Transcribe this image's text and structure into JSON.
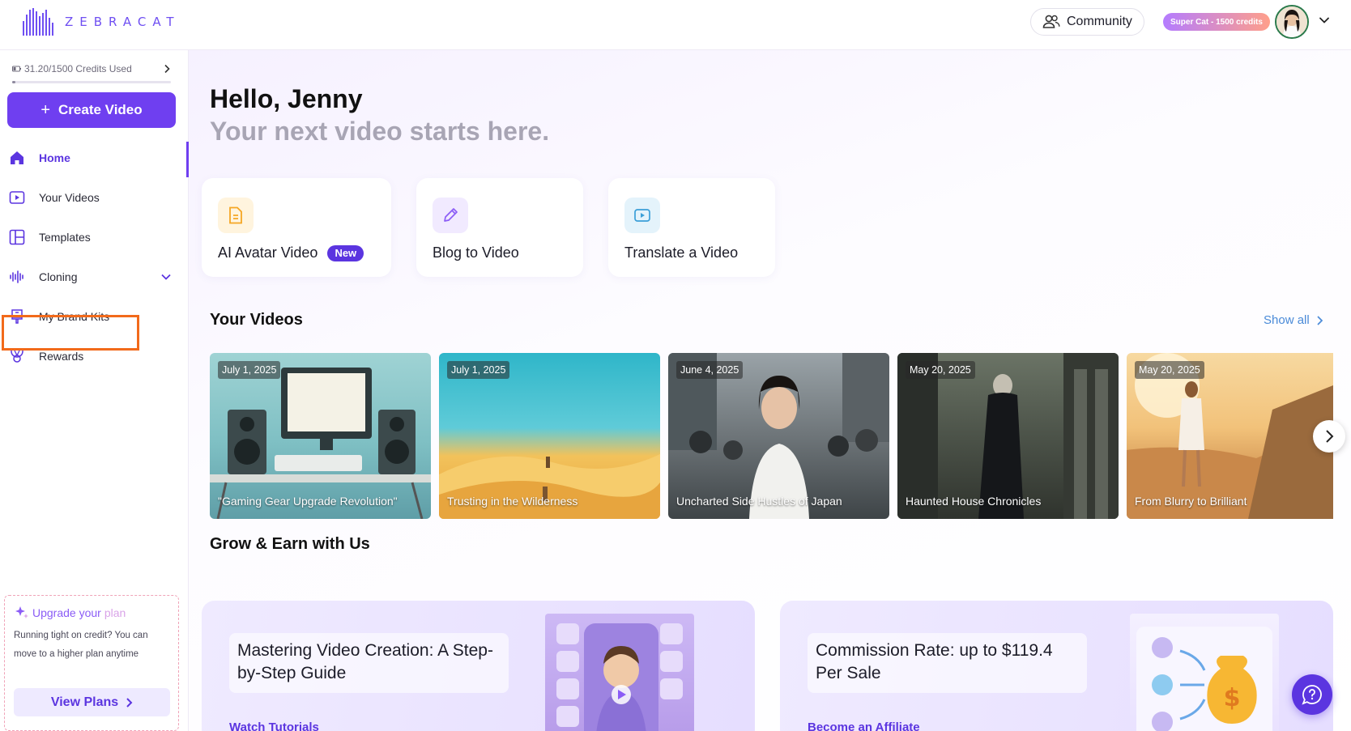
{
  "header": {
    "logo_text": "ZEBRACAT",
    "community_label": "Community",
    "plan_badge": "Super Cat - 1500 credits",
    "avatar_icon": "user-avatar"
  },
  "sidebar": {
    "credits_text": "31.20/1500 Credits Used",
    "credits_used_fraction": 0.0208,
    "create_label": "Create Video",
    "items": [
      {
        "label": "Home",
        "icon": "home-icon",
        "active": true
      },
      {
        "label": "Your Videos",
        "icon": "play-icon"
      },
      {
        "label": "Templates",
        "icon": "layout-icon"
      },
      {
        "label": "Cloning",
        "icon": "waveform-icon"
      },
      {
        "label": "My Brand Kits",
        "icon": "brand-icon"
      },
      {
        "label": "Rewards",
        "icon": "trophy-icon"
      }
    ],
    "upgrade": {
      "title_prefix": "Upgrade your",
      "title_suffix": "plan",
      "description": "Running tight on credit? You can move to a higher plan anytime",
      "button": "View Plans"
    }
  },
  "main": {
    "greeting": "Hello, Jenny",
    "subtitle": "Your next video starts here.",
    "actions": [
      {
        "label": "AI Avatar Video",
        "badge": "New",
        "color": "#f5a623"
      },
      {
        "label": "Blog to Video",
        "color": "#8b5cf6"
      },
      {
        "label": "Translate a Video",
        "color": "#3b9fd8"
      }
    ],
    "your_videos_title": "Your Videos",
    "show_all": "Show all",
    "videos": [
      {
        "date": "July 1, 2025",
        "title": "\"Gaming Gear Upgrade Revolution\""
      },
      {
        "date": "July 1, 2025",
        "title": "Trusting in the Wilderness"
      },
      {
        "date": "June 4, 2025",
        "title": "Uncharted Side Hustles of Japan"
      },
      {
        "date": "May 20, 2025",
        "title": "Haunted House Chronicles"
      },
      {
        "date": "May 20, 2025",
        "title": "From Blurry to Brilliant"
      }
    ],
    "grow_title": "Grow & Earn with Us",
    "promos": [
      {
        "title": "Mastering Video Creation: A Step-by-Step Guide",
        "link": "Watch Tutorials"
      },
      {
        "title": "Commission Rate: up to $119.4 Per Sale",
        "link": "Become an Affiliate"
      }
    ]
  }
}
